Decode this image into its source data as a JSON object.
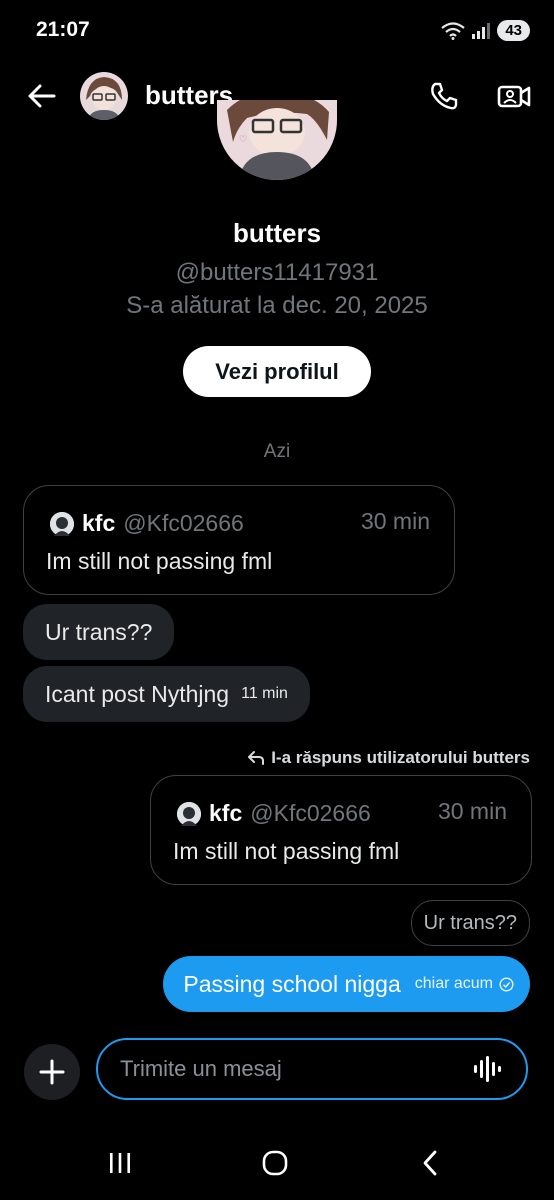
{
  "status": {
    "time": "21:07",
    "battery": "43"
  },
  "header": {
    "name": "butters"
  },
  "profile": {
    "name": "butters",
    "handle": "@butters11417931",
    "joined": "S-a alăturat la dec. 20, 2025",
    "view_button": "Vezi profilul"
  },
  "day_label": "Azi",
  "messages": {
    "quote1": {
      "name": "kfc",
      "handle": "@Kfc02666",
      "time": "30 min",
      "text": "Im still not passing fml"
    },
    "in1": {
      "text": "Ur trans??"
    },
    "in2": {
      "text": "Icant post Nythjng",
      "time": "11 min"
    },
    "reply_label": "I-a răspuns utilizatorului butters",
    "quote2": {
      "name": "kfc",
      "handle": "@Kfc02666",
      "time": "30 min",
      "text": "Im still not passing fml"
    },
    "reply_chip": "Ur trans??",
    "out1": {
      "text": "Passing school nigga",
      "time": "chiar acum"
    }
  },
  "composer": {
    "placeholder": "Trimite un mesaj"
  },
  "colors": {
    "accent": "#1d9bf0",
    "bubble_in": "#202327",
    "muted": "#71767b"
  }
}
